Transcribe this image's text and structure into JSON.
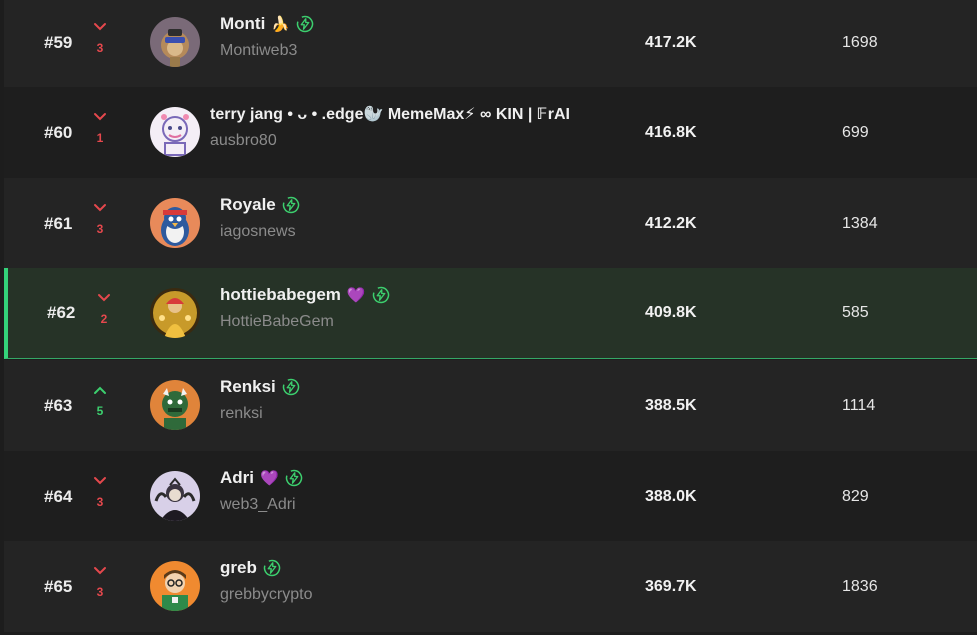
{
  "leaderboard": {
    "colors": {
      "down": "#e5484d",
      "up": "#3ccf6e",
      "highlight_bg": "#263327",
      "highlight_border": "#34d37a",
      "verified": "#3ccf6e"
    },
    "rows": [
      {
        "rank": "#59",
        "change": "3",
        "direction": "down",
        "name": "Monti",
        "emoji": "🍌",
        "verified": true,
        "handle": "Montiweb3",
        "score": "417.2K",
        "count": "1698",
        "avatar": "monkey"
      },
      {
        "rank": "#60",
        "change": "1",
        "direction": "down",
        "name": "terry jang • ᴗ • .edge🦭 MemeMax⚡ ∞ KIN | 𝔽rAI",
        "emoji": "",
        "verified": false,
        "handle": "ausbro80",
        "score": "416.8K",
        "count": "699",
        "avatar": "sketch"
      },
      {
        "rank": "#61",
        "change": "3",
        "direction": "down",
        "name": "Royale",
        "emoji": "",
        "verified": true,
        "handle": "iagosnews",
        "score": "412.2K",
        "count": "1384",
        "avatar": "penguin"
      },
      {
        "rank": "#62",
        "change": "2",
        "direction": "down",
        "name": "hottiebabegem",
        "emoji": "💜",
        "verified": true,
        "handle": "HottieBabeGem",
        "score": "409.8K",
        "count": "585",
        "avatar": "gold",
        "highlight": true
      },
      {
        "rank": "#63",
        "change": "5",
        "direction": "up",
        "name": "Renksi",
        "emoji": "",
        "verified": true,
        "handle": "renksi",
        "score": "388.5K",
        "count": "1114",
        "avatar": "dragon"
      },
      {
        "rank": "#64",
        "change": "3",
        "direction": "down",
        "name": "Adri",
        "emoji": "💜",
        "verified": true,
        "handle": "web3_Adri",
        "score": "388.0K",
        "count": "829",
        "avatar": "dark"
      },
      {
        "rank": "#65",
        "change": "3",
        "direction": "down",
        "name": "greb",
        "emoji": "",
        "verified": true,
        "handle": "grebbycrypto",
        "score": "369.7K",
        "count": "1836",
        "avatar": "greb"
      }
    ]
  }
}
